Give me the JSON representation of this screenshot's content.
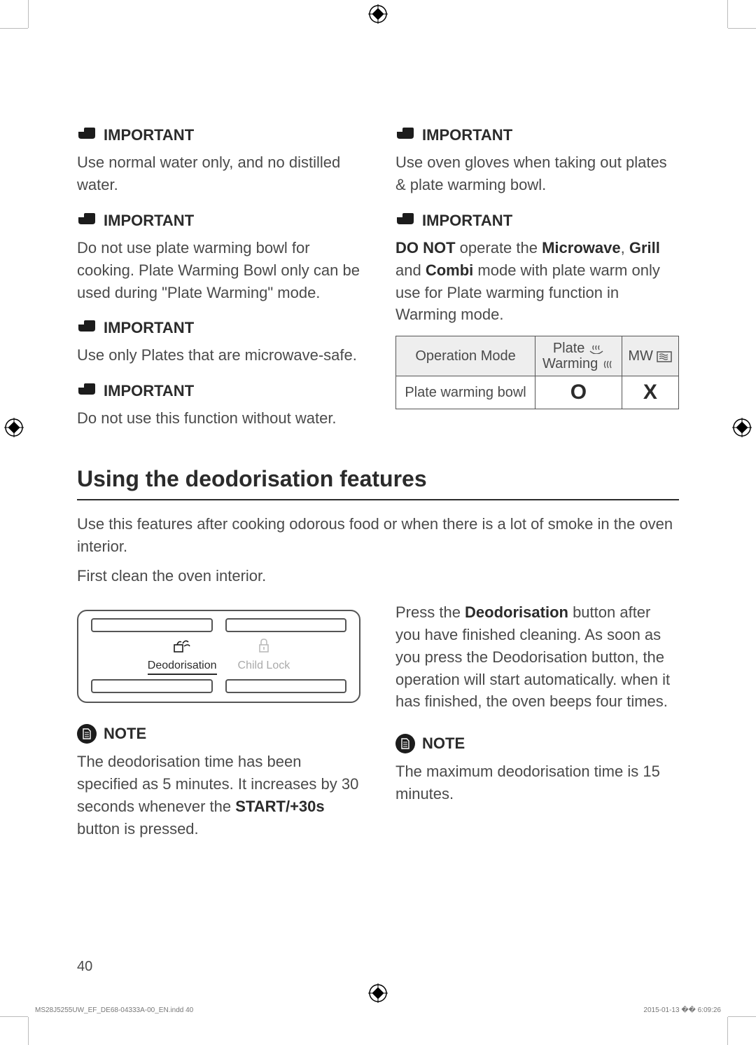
{
  "labels": {
    "important": "IMPORTANT",
    "note": "NOTE"
  },
  "left_col": {
    "blocks": [
      {
        "type": "important",
        "text": "Use normal water only, and no distilled water."
      },
      {
        "type": "important",
        "text": "Do not use plate warming bowl for cooking. Plate Warming Bowl only can be used during \"Plate Warming\" mode."
      },
      {
        "type": "important",
        "text": "Use only Plates that are microwave-safe."
      },
      {
        "type": "important",
        "text": "Do not use this function without water."
      }
    ]
  },
  "right_col": {
    "blocks": [
      {
        "type": "important",
        "text": "Use oven gloves when taking out plates & plate warming bowl."
      },
      {
        "type": "important",
        "pre_bold": "DO NOT",
        "mid1": " operate the ",
        "b1": "Microwave",
        "mid2": ", ",
        "b2": "Grill",
        "mid3": " and ",
        "b3": "Combi",
        "post": " mode with plate warm only use for Plate warming function in Warming mode."
      }
    ],
    "table": {
      "h1": "Operation Mode",
      "h2_top": "Plate",
      "h2_bot": "Warming",
      "h3": "MW",
      "row_label": "Plate warming bowl",
      "row_c2": "O",
      "row_c3": "X"
    }
  },
  "section": {
    "title": "Using the deodorisation features",
    "intro": "Use this features after cooking odorous food or when there is a lot of smoke in the oven interior.",
    "intro2": "First clean the oven interior.",
    "panel": {
      "btn_active": "Deodorisation",
      "btn_dim": "Child Lock"
    },
    "right_para_pre": "Press the ",
    "right_para_b": "Deodorisation",
    "right_para_post": " button after you have finished cleaning. As soon as you press the Deodorisation button, the operation will start automatically. when it has finished, the oven beeps four times.",
    "note_left_pre": "The deodorisation time has been specified as 5 minutes. It increases by 30 seconds whenever the ",
    "note_left_b": "START/+30s",
    "note_left_post": " button is pressed.",
    "note_right": "The maximum deodorisation time is 15 minutes."
  },
  "page_number": "40",
  "footer": {
    "left": "MS28J5255UW_EF_DE68-04333A-00_EN.indd   40",
    "right": "2015-01-13   �� 6:09:26"
  }
}
